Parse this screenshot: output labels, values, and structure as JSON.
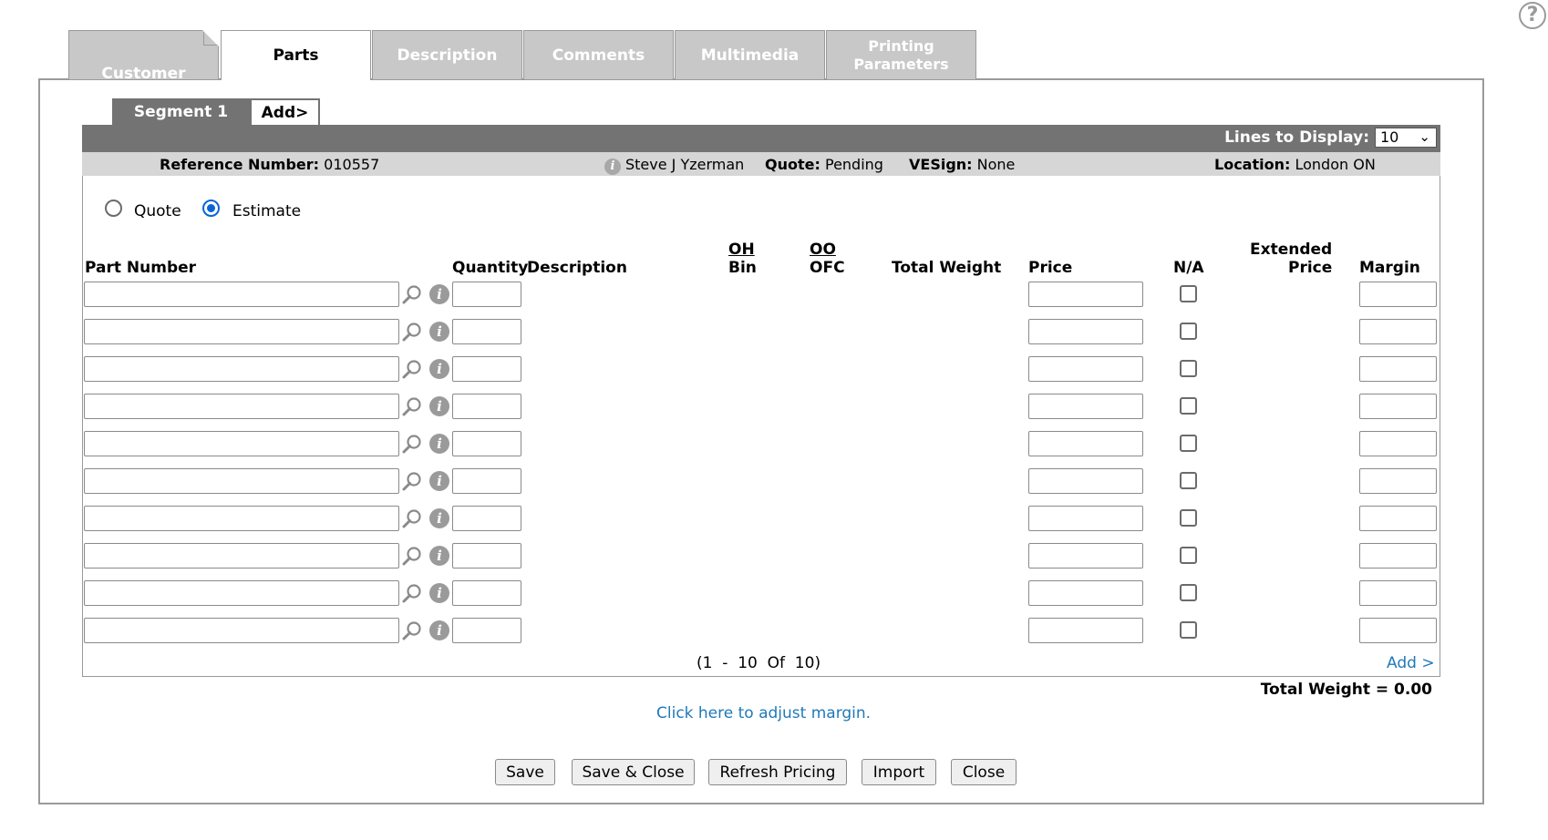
{
  "help": {
    "icon": "help-icon",
    "symbol": "?"
  },
  "tabs": [
    {
      "label": "Customer"
    },
    {
      "label": "Parts"
    },
    {
      "label": "Description"
    },
    {
      "label": "Comments"
    },
    {
      "label": "Multimedia"
    },
    {
      "label": "Printing Parameters"
    }
  ],
  "segments": {
    "segment1": "Segment 1",
    "add": "Add>"
  },
  "toolbar": {
    "lines_label": "Lines to Display:",
    "lines_value": "10"
  },
  "info": {
    "ref_label": "Reference Number:",
    "ref_value": "010557",
    "person": "Steve J Yzerman",
    "quote_label": "Quote:",
    "quote_value": "Pending",
    "vesign_label": "VESign:",
    "vesign_value": "None",
    "location_label": "Location:",
    "location_value": "London ON"
  },
  "mode": {
    "quote": "Quote",
    "estimate": "Estimate",
    "selected": "Estimate"
  },
  "columns": {
    "part_number": "Part Number",
    "quantity": "Quantity",
    "description": "Description",
    "oh": "OH",
    "bin": "Bin",
    "oo": "OO",
    "ofc": "OFC",
    "total_weight": "Total Weight",
    "price": "Price",
    "na": "N/A",
    "extended": "Extended",
    "price2": "Price",
    "margin": "Margin"
  },
  "rows": 10,
  "footer": {
    "pager": "(1  -  10  Of  10)",
    "add": "Add >",
    "total_weight": "Total Weight = 0.00",
    "adjust_margin": "Click here to adjust margin."
  },
  "buttons": {
    "save": "Save",
    "save_close": "Save & Close",
    "refresh": "Refresh Pricing",
    "import": "Import",
    "close": "Close"
  },
  "colors": {
    "tab_gray": "#c8c8c8",
    "bar_dark": "#737373",
    "bar_light": "#d6d6d6",
    "link": "#1f7ab8",
    "radio": "#0a64d8"
  }
}
